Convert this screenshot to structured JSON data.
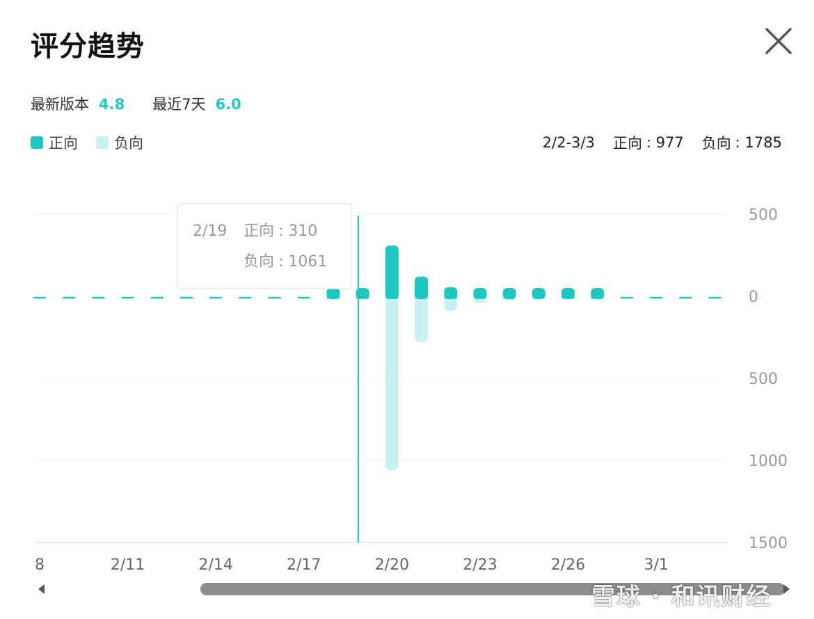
{
  "header": {
    "title": "评分趋势",
    "close_icon": "close-icon"
  },
  "stats": {
    "latest_label": "最新版本",
    "latest_value": "4.8",
    "recent_label": "最近7天",
    "recent_value": "6.0"
  },
  "legend": {
    "positive": "正向",
    "negative": "负向"
  },
  "summary": {
    "range": "2/2-3/3",
    "positive_label": "正向",
    "positive_total": ": 977",
    "negative_label": "负向",
    "negative_total": ": 1785"
  },
  "colors": {
    "positive": "#1ec8c0",
    "negative": "#c8f1f1",
    "accent": "#20c9c2"
  },
  "tooltip": {
    "date": "2/19",
    "positive_label": "正向",
    "positive_value": ": 310",
    "negative_label": "负向",
    "negative_value": ": 1061"
  },
  "chart_data": {
    "type": "bar",
    "categories": [
      "2/8",
      "2/9",
      "2/10",
      "2/11",
      "2/12",
      "2/13",
      "2/14",
      "2/15",
      "2/16",
      "2/17",
      "2/18",
      "2/19",
      "2/20",
      "2/21",
      "2/22",
      "2/23",
      "2/24",
      "2/25",
      "2/26",
      "2/27",
      "2/28",
      "3/1",
      "3/2",
      "3/3"
    ],
    "series": [
      {
        "name": "正向",
        "values": [
          0,
          0,
          0,
          0,
          0,
          0,
          0,
          0,
          0,
          0,
          35,
          25,
          310,
          120,
          55,
          30,
          20,
          18,
          15,
          18,
          5,
          5,
          5,
          5
        ]
      },
      {
        "name": "负向",
        "values": [
          0,
          0,
          0,
          0,
          0,
          0,
          0,
          0,
          0,
          0,
          5,
          5,
          1061,
          280,
          90,
          40,
          25,
          15,
          10,
          10,
          5,
          5,
          5,
          5
        ]
      }
    ],
    "x_tick_labels": [
      "8",
      "2/11",
      "2/14",
      "2/17",
      "2/20",
      "2/23",
      "2/26",
      "3/1"
    ],
    "x_tick_indices": [
      0,
      3,
      6,
      9,
      12,
      15,
      18,
      21
    ],
    "y_tick_labels": [
      "500",
      "0",
      "500",
      "1000",
      "1500"
    ],
    "y_tick_values": [
      500,
      0,
      -500,
      -1000,
      -1500
    ],
    "ylim": [
      -1500,
      500
    ],
    "highlight_index": 11,
    "grid": true,
    "legend_position": "top-left"
  },
  "scrollbar": {
    "left_icon": "scroll-left-arrow-icon",
    "right_icon": "scroll-right-arrow-icon"
  },
  "watermark": {
    "text": "雪球 · 和讯财经"
  }
}
